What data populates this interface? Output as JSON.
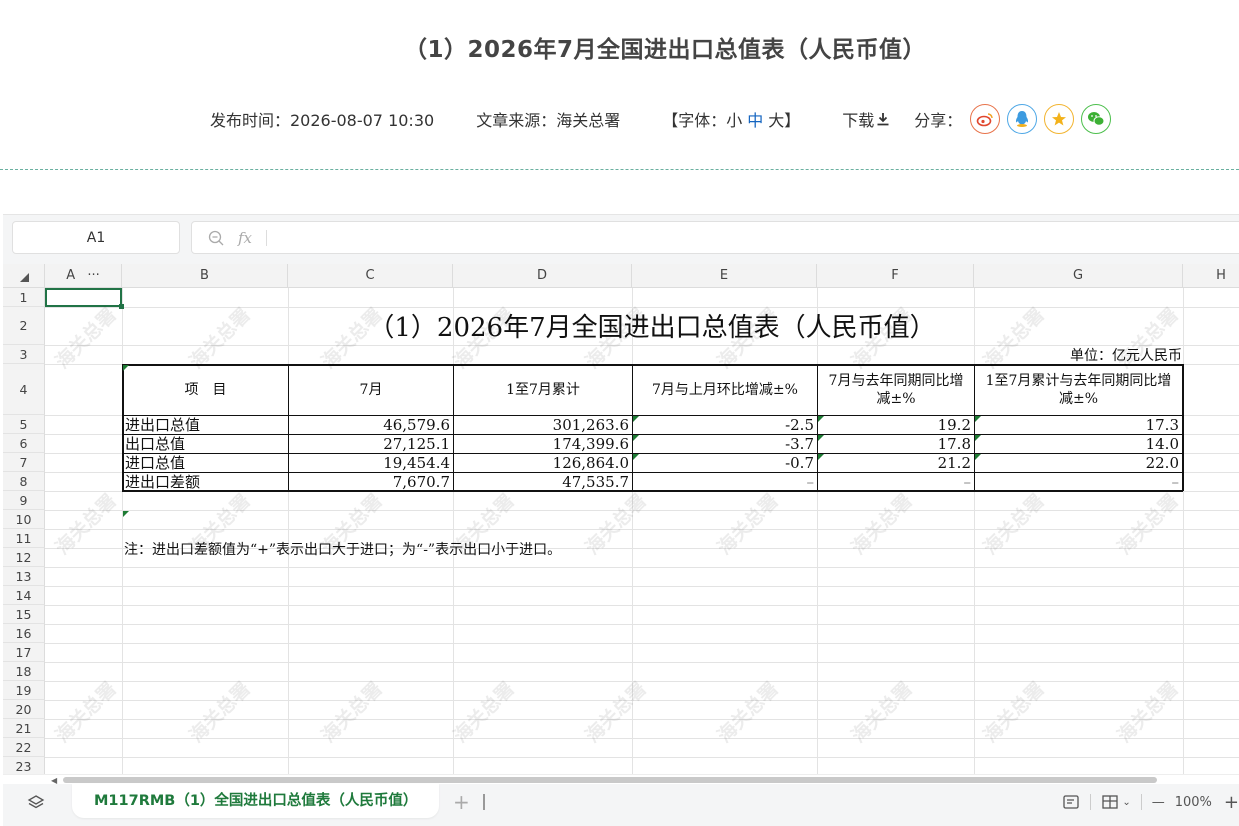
{
  "article": {
    "title": "（1）2026年7月全国进出口总值表（人民币值）",
    "publish": "发布时间：2026-08-07 10:30",
    "source": "文章来源：海关总署",
    "font_prefix": "【字体：",
    "font_small": "小",
    "font_medium": "中",
    "font_large": "大",
    "font_suffix": "】",
    "download": "下载",
    "share": "分享：",
    "share_icons": [
      "weibo-icon",
      "qq-icon",
      "qzone-icon",
      "wechat-icon"
    ],
    "accent": "#1565c0"
  },
  "viewer": {
    "namebox": "A1",
    "formula": "",
    "columns": [
      "A",
      "B",
      "C",
      "D",
      "E",
      "F",
      "G",
      "H"
    ],
    "rows": [
      "1",
      "2",
      "3",
      "4",
      "5",
      "6",
      "7",
      "8",
      "9",
      "10",
      "11",
      "12",
      "13",
      "14",
      "15",
      "16",
      "17",
      "18",
      "19",
      "20",
      "21",
      "22",
      "23"
    ],
    "sheet_tab": "M117RMB（1）全国进出口总值表（人民币值）",
    "add_sheet": "+",
    "zoom": "100%",
    "zoom_out": "—",
    "zoom_in": "+",
    "col_menu": "···",
    "watermark": "海关总署",
    "grid_color": "#e3e3e3",
    "selection_color": "#217346"
  },
  "sheet": {
    "title": "（1）2026年7月全国进出口总值表（人民币值）",
    "unit": "单位：亿元人民币",
    "headers": [
      "项　目",
      "7月",
      "1至7月累计",
      "7月与上月环比增减±%",
      "7月与去年同期同比增减±%",
      "1至7月累计与去年同期同比增减±%"
    ],
    "rows": [
      [
        "进出口总值",
        "46,579.6",
        "301,263.6",
        "-2.5",
        "19.2",
        "17.3"
      ],
      [
        "出口总值",
        "27,125.1",
        "174,399.6",
        "-3.7",
        "17.8",
        "14.0"
      ],
      [
        "进口总值",
        "19,454.4",
        "126,864.0",
        "-0.7",
        "21.2",
        "22.0"
      ],
      [
        "进出口差额",
        "7,670.7",
        "47,535.7",
        "–",
        "–",
        "–"
      ]
    ],
    "note": "注：进出口差额值为“+”表示出口大于进口；为“-”表示出口小于进口。"
  }
}
